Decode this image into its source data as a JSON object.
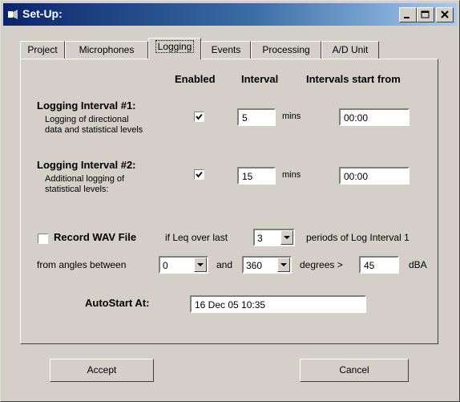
{
  "window": {
    "title": "Set-Up:"
  },
  "tabs": [
    {
      "label": "Project"
    },
    {
      "label": "Microphones"
    },
    {
      "label": "Logging"
    },
    {
      "label": "Events"
    },
    {
      "label": "Processing"
    },
    {
      "label": "A/D Unit"
    }
  ],
  "columns": {
    "enabled": "Enabled",
    "interval": "Interval",
    "start": "Intervals start from"
  },
  "interval1": {
    "title": "Logging Interval #1:",
    "desc_line1": "Logging of directional",
    "desc_line2": "data and statistical levels",
    "enabled": true,
    "value": "5",
    "unit": "mins",
    "start": "00:00"
  },
  "interval2": {
    "title": "Logging Interval #2:",
    "desc_line1": "Additional logging of",
    "desc_line2": "statistical levels:",
    "enabled": true,
    "value": "15",
    "unit": "mins",
    "start": "00:00"
  },
  "wav": {
    "checked": false,
    "label": "Record WAV File",
    "if_text": "if Leq over last",
    "periods_value": "3",
    "periods_text": "periods of Log Interval 1",
    "from_text": "from angles between",
    "angle_from": "0",
    "and_text": "and",
    "angle_to": "360",
    "degrees_text": "degrees >",
    "threshold": "45",
    "unit": "dBA"
  },
  "autostart": {
    "label": "AutoStart At:",
    "value": "16 Dec 05 10:35"
  },
  "buttons": {
    "accept": "Accept",
    "cancel": "Cancel"
  },
  "colors": {
    "face": "#d4d0c8",
    "title_start": "#0a246a",
    "title_end": "#a6caf0"
  },
  "icons": [
    "app-icon",
    "minimize-icon",
    "maximize-icon",
    "close-icon",
    "checkmark-icon",
    "dropdown-arrow-icon"
  ]
}
